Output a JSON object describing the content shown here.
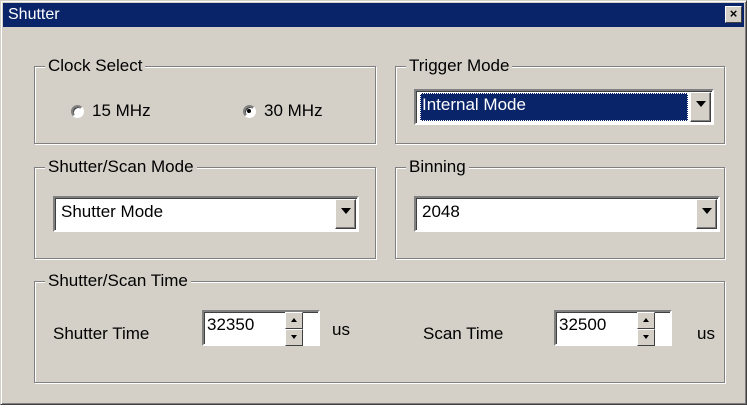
{
  "window": {
    "title": "Shutter",
    "close_glyph": "×"
  },
  "clock_select": {
    "label": "Clock Select",
    "options": [
      {
        "label": "15 MHz",
        "checked": false
      },
      {
        "label": "30 MHz",
        "checked": true
      }
    ]
  },
  "trigger_mode": {
    "label": "Trigger Mode",
    "value": "Internal Mode"
  },
  "shutter_scan_mode": {
    "label": "Shutter/Scan Mode",
    "value": "Shutter Mode"
  },
  "binning": {
    "label": "Binning",
    "value": "2048"
  },
  "shutter_scan_time": {
    "label": "Shutter/Scan Time",
    "shutter_time": {
      "label": "Shutter Time",
      "value": "32350",
      "unit": "us"
    },
    "scan_time": {
      "label": "Scan Time",
      "value": "32500",
      "unit": "us"
    }
  },
  "colors": {
    "titlebar": "#0a246a",
    "face": "#d4d0c8",
    "selection": "#0a246a"
  },
  "icons": {
    "close": "close-icon",
    "dropdown": "chevron-down-icon",
    "spin_up": "spin-up-icon",
    "spin_down": "spin-down-icon"
  }
}
